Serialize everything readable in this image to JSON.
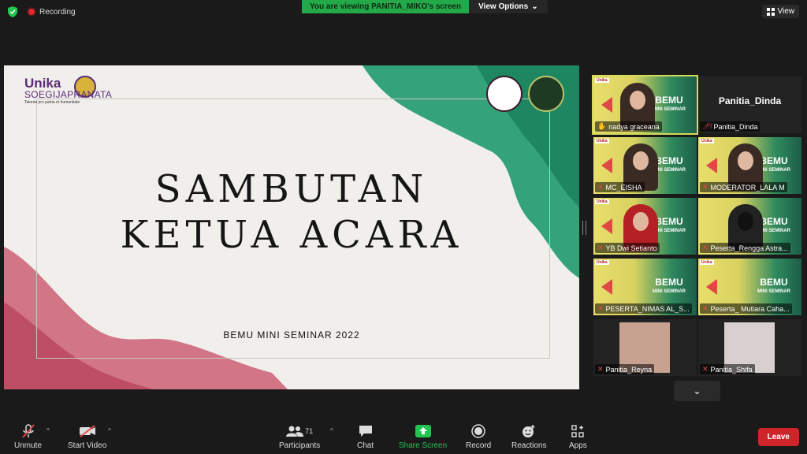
{
  "top": {
    "recording_label": "Recording",
    "viewing_banner": "You are viewing PANITIA_MIKO's screen",
    "view_options": "View Options",
    "view_button": "View"
  },
  "slide": {
    "logo_line1": "Unika",
    "logo_line2": "SOEGIJAPRANATA",
    "logo_tagline": "Talenta pro patria et humanitate",
    "title_line1": "SAMBUTAN",
    "title_line2": "KETUA ACARA",
    "subtitle": "BEMU MINI SEMINAR 2022"
  },
  "gallery": {
    "tiles": [
      {
        "name": "nadya graceana"
      },
      {
        "name": "Panitia_Dinda",
        "big_name": "Panitia_Dinda"
      },
      {
        "name": "MC_EISHA"
      },
      {
        "name": "MODERATOR_LALA M"
      },
      {
        "name": "YB Dwi Setianto"
      },
      {
        "name": "Peserta_Rengga Astra..."
      },
      {
        "name": "PESERTA_NIMAS AL_S..."
      },
      {
        "name": "Peserta_ Mutiara Caha..."
      },
      {
        "name": "Panitia_Reyna"
      },
      {
        "name": "Panitia_Shifa"
      }
    ],
    "bemu_text": "BEMU",
    "bemu_sub": "MINI SEMINAR"
  },
  "toolbar": {
    "unmute": "Unmute",
    "start_video": "Start Video",
    "participants": "Participants",
    "participants_count": "71",
    "chat": "Chat",
    "share_screen": "Share Screen",
    "record": "Record",
    "reactions": "Reactions",
    "apps": "Apps",
    "leave": "Leave"
  },
  "colors": {
    "share_green": "#23c552",
    "leave_red": "#d0242b",
    "banner_green": "#23a84a"
  }
}
